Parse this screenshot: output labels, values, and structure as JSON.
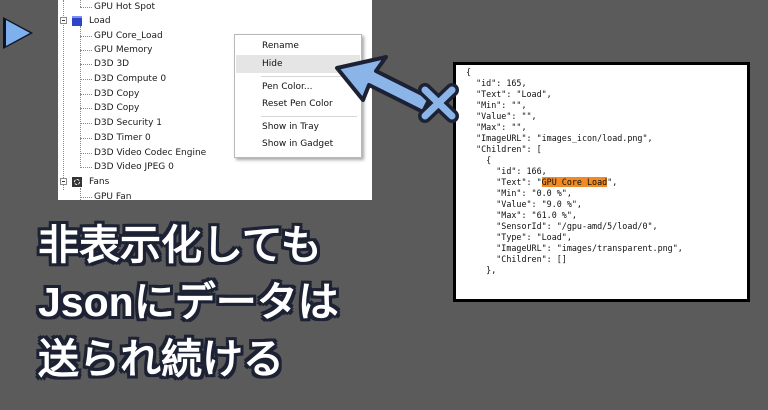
{
  "tree": {
    "items": [
      {
        "label": "GPU Hot Spot"
      },
      {
        "label": "Load"
      },
      {
        "label": "GPU Core_Load"
      },
      {
        "label": "GPU Memory"
      },
      {
        "label": "D3D 3D"
      },
      {
        "label": "D3D Compute 0"
      },
      {
        "label": "D3D Copy"
      },
      {
        "label": "D3D Copy"
      },
      {
        "label": "D3D Security 1"
      },
      {
        "label": "D3D Timer 0"
      },
      {
        "label": "D3D Video Codec Engine"
      },
      {
        "label": "D3D Video JPEG 0"
      },
      {
        "label": "Fans"
      },
      {
        "label": "GPU Fan"
      }
    ]
  },
  "context_menu": {
    "rename": "Rename",
    "hide": "Hide",
    "pen_color": "Pen Color...",
    "reset_pen_color": "Reset Pen Color",
    "show_in_tray": "Show in Tray",
    "show_in_gadget": "Show in Gadget"
  },
  "json_view": {
    "lines": [
      "{",
      "  \"id\": 165,",
      "  \"Text\": \"Load\",",
      "  \"Min\": \"\",",
      "  \"Value\": \"\",",
      "  \"Max\": \"\",",
      "  \"ImageURL\": \"images_icon/load.png\",",
      "  \"Children\": [",
      "    {",
      "      \"id\": 166,",
      "      \"Text\": \"GPU Core Load\",",
      "      \"Min\": \"0.0 %\",",
      "      \"Value\": \"9.0 %\",",
      "      \"Max\": \"61.0 %\",",
      "      \"SensorId\": \"/gpu-amd/5/load/0\",",
      "      \"Type\": \"Load\",",
      "      \"ImageURL\": \"images/transparent.png\",",
      "      \"Children\": []",
      "    },"
    ],
    "highlight_line_index": 10,
    "highlight_prefix": "      \"Text\": \"",
    "highlight_text": "GPU Core Load",
    "highlight_suffix": "\","
  },
  "caption": {
    "line1": "非表示化しても",
    "line2": "Jsonにデータは",
    "line3": "送られ続ける"
  },
  "colors": {
    "background": "#5b5b5b",
    "arrow_fill": "#8bb4e8",
    "outline": "#1c2233",
    "highlight": "#f08a24"
  }
}
